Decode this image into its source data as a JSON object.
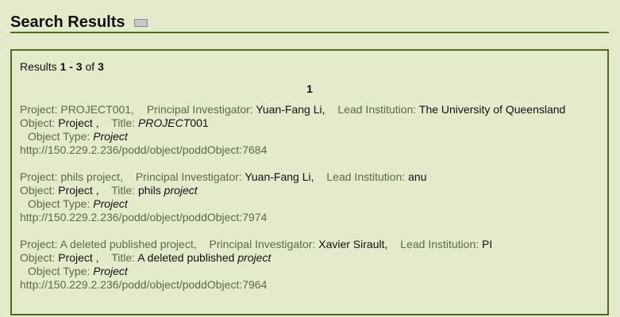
{
  "header": {
    "title": "Search Results",
    "icon": "keyboard-icon"
  },
  "summary": {
    "prefix": "Results",
    "range": "1 - 3",
    "of": "of",
    "total": "3"
  },
  "pager": {
    "current_page": "1"
  },
  "results": [
    {
      "project_label": "Project:",
      "project_value": "PROJECT001,",
      "pi_label": "Principal Investigator:",
      "pi_value": "Yuan-Fang Li,",
      "institution_label": "Lead Institution:",
      "institution_value": "The University of Queensland",
      "object_label": "Object:",
      "object_value": "Project ,",
      "title_label": "Title:",
      "title_value_italic": "PROJECT",
      "title_value_rest": "001",
      "type_label": "Object Type:",
      "type_value": "Project",
      "url": "http://150.229.2.236/podd/object/poddObject:7684"
    },
    {
      "project_label": "Project:",
      "project_value": "phils project,",
      "pi_label": "Principal Investigator:",
      "pi_value": "Yuan-Fang Li,",
      "institution_label": "Lead Institution:",
      "institution_value": "anu",
      "object_label": "Object:",
      "object_value": "Project ,",
      "title_label": "Title:",
      "title_value_plain": "phils",
      "title_value_italic": "project",
      "type_label": "Object Type:",
      "type_value": "Project",
      "url": "http://150.229.2.236/podd/object/poddObject:7974"
    },
    {
      "project_label": "Project:",
      "project_value": "A deleted published project,",
      "pi_label": "Principal Investigator:",
      "pi_value": "Xavier Sirault,",
      "institution_label": "Lead Institution:",
      "institution_value": "PI",
      "object_label": "Object:",
      "object_value": "Project ,",
      "title_label": "Title:",
      "title_value_plain": "A deleted published",
      "title_value_italic": "project",
      "type_label": "Object Type:",
      "type_value": "Project",
      "url": "http://150.229.2.236/podd/object/poddObject:7964"
    }
  ]
}
